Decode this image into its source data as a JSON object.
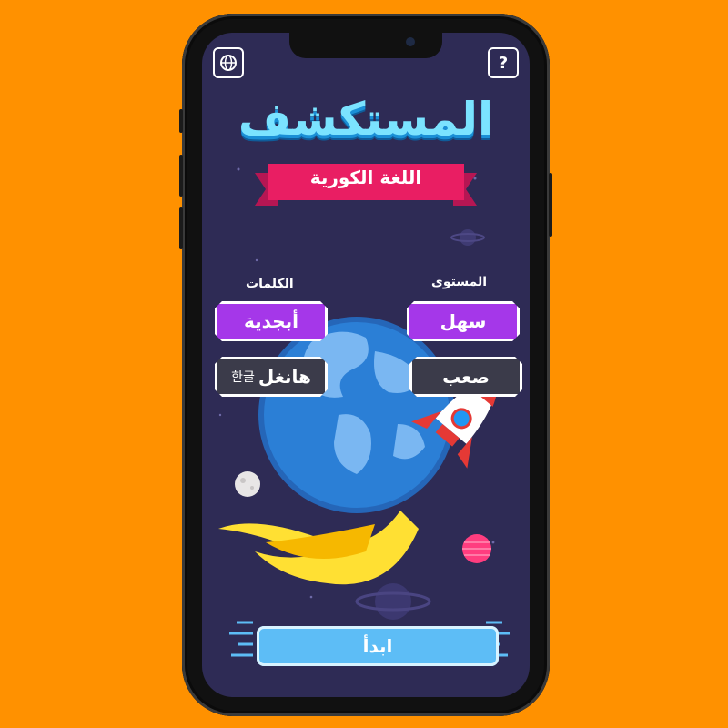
{
  "background_color": "#ff9100",
  "top_bar": {
    "globe_icon": "globe-icon",
    "help_label": "?"
  },
  "title": "المستكشف",
  "subtitle": "اللغة الكورية",
  "level": {
    "label": "المستوى",
    "options": [
      "سهل",
      "صعب"
    ],
    "selected": "سهل"
  },
  "words": {
    "label": "الكلمات",
    "options": [
      "أبجدية",
      "هانغل"
    ],
    "hangul": "한글",
    "selected": "أبجدية"
  },
  "start_button": "ابدأ",
  "colors": {
    "accent_purple": "#a537e9",
    "dark_button": "#3b3b4a",
    "start_blue": "#5dbdf6",
    "screen_bg": "#2e2b55"
  }
}
